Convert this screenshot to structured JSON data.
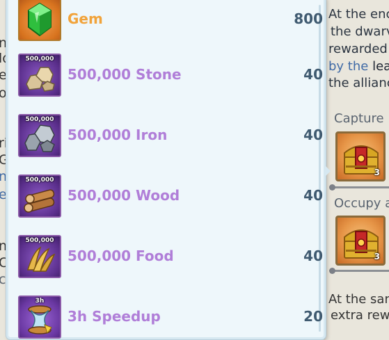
{
  "popup": {
    "items": [
      {
        "name": "Gem",
        "price": "800",
        "icon": "gem-icon",
        "tag": ""
      },
      {
        "name": "500,000 Stone",
        "price": "40",
        "icon": "stone-icon",
        "tag": "500,000"
      },
      {
        "name": "500,000 Iron",
        "price": "40",
        "icon": "iron-icon",
        "tag": "500,000"
      },
      {
        "name": "500,000 Wood",
        "price": "40",
        "icon": "wood-icon",
        "tag": "500,000"
      },
      {
        "name": "500,000 Food",
        "price": "40",
        "icon": "food-icon",
        "tag": "500,000"
      },
      {
        "name": "3h Speedup",
        "price": "20",
        "icon": "speedup-icon",
        "tag": "3h"
      }
    ]
  },
  "background": {
    "left_fragments": [
      "n",
      "lo",
      "er",
      "or",
      "ri",
      "G",
      "n",
      "ec",
      "n",
      "C",
      "c"
    ],
    "right_text": {
      "line1": "At the enc",
      "line2": "the dwarv",
      "line3": "rewarded",
      "line4_a": "by the",
      "line4_b": "lea",
      "line5": "the allianc",
      "capture_title": "Capture",
      "occupy_title": "Occupy a",
      "chest_count_1": "3",
      "chest_count_2": "3",
      "bottom_line1": "At the san",
      "bottom_line2": "extra rew"
    }
  },
  "colors": {
    "item_name_purple": "#b07ed8",
    "gem_name_gold": "#f1a33a",
    "price_slate": "#3f5a70",
    "popup_bg": "#eef7fb"
  }
}
